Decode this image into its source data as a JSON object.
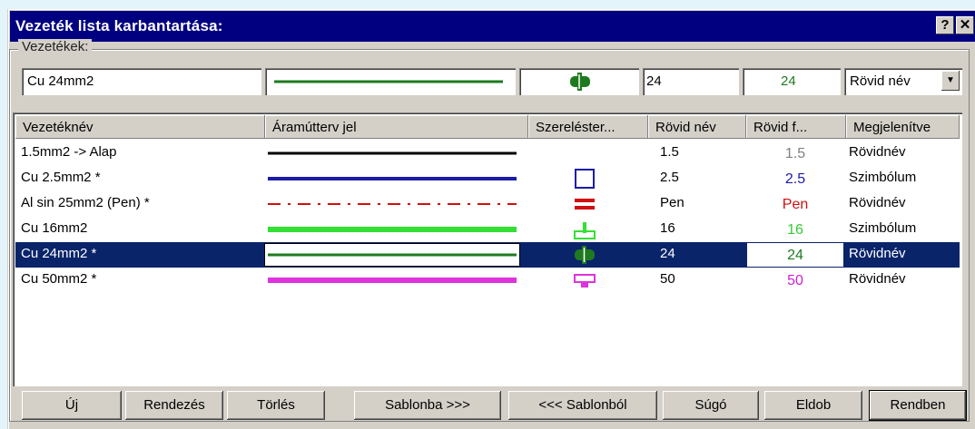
{
  "window": {
    "title": "Vezeték lista karbantartása:",
    "help_btn": "?",
    "close_btn": "✕"
  },
  "group": {
    "label": "Vezetékek:"
  },
  "editor": {
    "name_value": "Cu 24mm2",
    "short_name_value": "24",
    "short_label_value": "24",
    "display_value": "Rövid név",
    "line_color": "#1f7a1f",
    "symbol_color": "#1f7a1f"
  },
  "columns": [
    "Vezetéknév",
    "Áramútterv jel",
    "Szereléster...",
    "Rövid név",
    "Rövid f...",
    "Megjelenítve"
  ],
  "rows": [
    {
      "name": "1.5mm2 -> Alap",
      "short": "1.5",
      "label": "1.5",
      "label_color": "#808080",
      "display": "Rövidnév",
      "line_color": "#000000",
      "line_style": "solid",
      "line_width": 3,
      "symbol": "none"
    },
    {
      "name": "Cu 2.5mm2 *",
      "short": "2.5",
      "label": "2.5",
      "label_color": "#1c1ca8",
      "display": "Szimbólum",
      "line_color": "#1c1ca8",
      "line_style": "solid",
      "line_width": 4,
      "symbol": "square"
    },
    {
      "name": "Al sin 25mm2 (Pen) *",
      "short": "Pen",
      "label": "Pen",
      "label_color": "#d01010",
      "display": "Rövidnév",
      "line_color": "#d01010",
      "line_style": "dashdot",
      "line_width": 2,
      "symbol": "double-bar"
    },
    {
      "name": "Cu 16mm2",
      "short": "16",
      "label": "16",
      "label_color": "#33cc33",
      "display": "Szimbólum",
      "line_color": "#33e033",
      "line_style": "solid",
      "line_width": 6,
      "symbol": "t-shape"
    },
    {
      "name": "Cu 24mm2 *",
      "short": "24",
      "label": "24",
      "label_color": "#1f7a1f",
      "display": "Rövidnév",
      "line_color": "#1f7a1f",
      "line_style": "solid",
      "line_width": 3,
      "symbol": "plug",
      "selected": true
    },
    {
      "name": "Cu 50mm2 *",
      "short": "50",
      "label": "50",
      "label_color": "#cc22cc",
      "display": "Rövidnév",
      "line_color": "#dd33dd",
      "line_style": "solid",
      "line_width": 6,
      "symbol": "down-box"
    }
  ],
  "buttons": {
    "new": "Új",
    "sort": "Rendezés",
    "delete": "Törlés",
    "to_template": "Sablonba >>>",
    "from_template": "<<< Sablonból",
    "help": "Súgó",
    "discard": "Eldob",
    "ok": "Rendben"
  }
}
